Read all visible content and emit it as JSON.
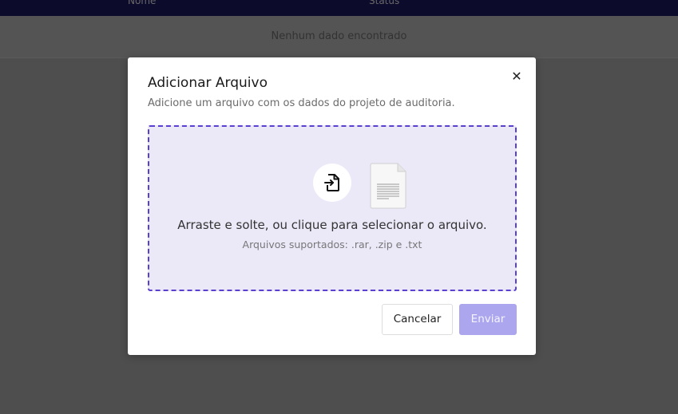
{
  "background": {
    "header_left": "Nome",
    "header_right": "Status",
    "empty_message": "Nenhum dado encontrado"
  },
  "modal": {
    "title": "Adicionar Arquivo",
    "subtitle": "Adicione um arquivo com os dados do projeto de auditoria.",
    "close_icon": "close-icon",
    "dropzone": {
      "instruction": "Arraste e solte, ou clique para selecionar o arquivo.",
      "supported": "Arquivos suportados: .rar, .zip e .txt",
      "upload_icon": "file-import-icon",
      "preview_icon": "text-document-icon"
    },
    "buttons": {
      "cancel": "Cancelar",
      "submit": "Enviar"
    }
  },
  "colors": {
    "accent": "#5b3fcf",
    "dropzone_bg": "#ebe8f8",
    "submit_disabled": "#aca6ee",
    "topbar": "#0e0d33"
  }
}
